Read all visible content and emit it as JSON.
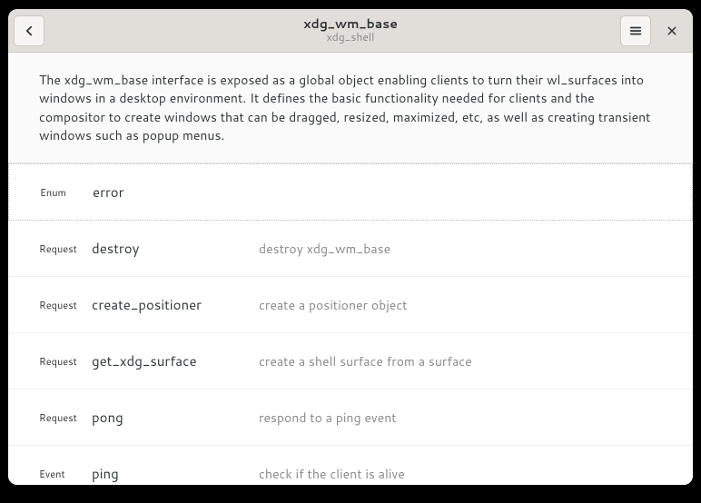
{
  "header": {
    "title": "xdg_wm_base",
    "subtitle": "xdg_shell"
  },
  "description": "The xdg_wm_base interface is exposed as a global object enabling clients to turn their wl_surfaces into windows in a desktop environment. It defines the basic functionality needed for clients and the compositor to create windows that can be dragged, resized, maximized, etc, as well as creating transient windows such as popup menus.",
  "rows": [
    {
      "kind": "Enum",
      "name": "error",
      "summary": ""
    },
    {
      "kind": "Request",
      "name": "destroy",
      "summary": "destroy xdg_wm_base"
    },
    {
      "kind": "Request",
      "name": "create_positioner",
      "summary": "create a positioner object"
    },
    {
      "kind": "Request",
      "name": "get_xdg_surface",
      "summary": "create a shell surface from a surface"
    },
    {
      "kind": "Request",
      "name": "pong",
      "summary": "respond to a ping event"
    },
    {
      "kind": "Event",
      "name": "ping",
      "summary": "check if the client is alive"
    }
  ]
}
